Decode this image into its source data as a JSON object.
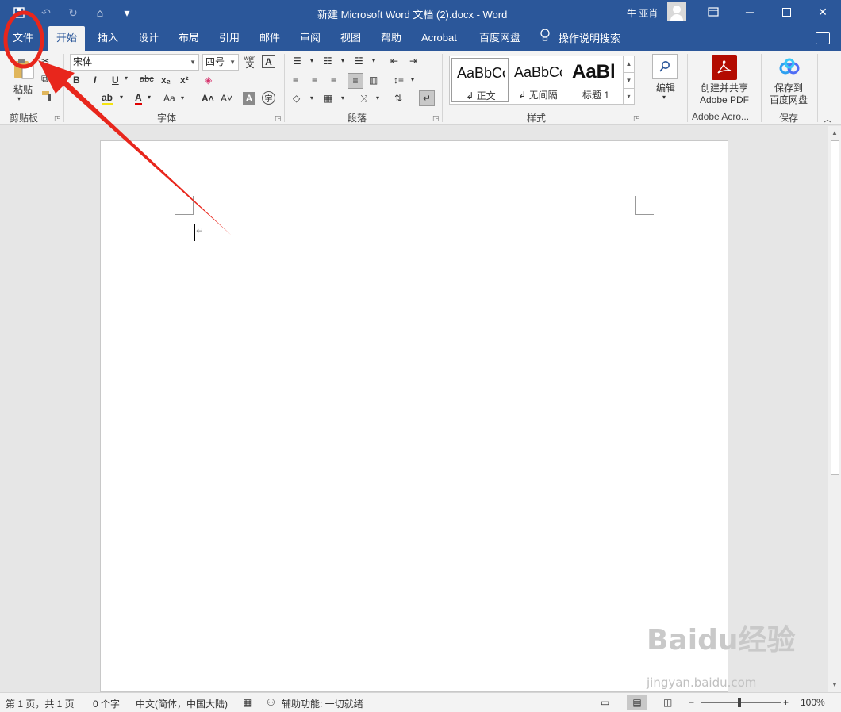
{
  "titlebar": {
    "doc_title": "新建 Microsoft Word 文档 (2).docx  -  Word",
    "user_name": "牛 亚肖",
    "bg_color": "#2b579a"
  },
  "tabs": [
    {
      "label": "文件"
    },
    {
      "label": "开始"
    },
    {
      "label": "插入"
    },
    {
      "label": "设计"
    },
    {
      "label": "布局"
    },
    {
      "label": "引用"
    },
    {
      "label": "邮件"
    },
    {
      "label": "审阅"
    },
    {
      "label": "视图"
    },
    {
      "label": "帮助"
    },
    {
      "label": "Acrobat"
    },
    {
      "label": "百度网盘"
    }
  ],
  "tell_me": "操作说明搜索",
  "ribbon": {
    "clipboard": {
      "paste": "粘贴",
      "label": "剪贴板"
    },
    "font": {
      "name": "宋体",
      "size": "四号",
      "label": "字体",
      "wen": "wén",
      "wen_char": "文"
    },
    "paragraph": {
      "label": "段落"
    },
    "styles": {
      "label": "样式",
      "items": [
        {
          "sample": "AaBbCcI",
          "name": "↲ 正文"
        },
        {
          "sample": "AaBbCcI",
          "name": "↲ 无间隔"
        },
        {
          "sample": "AaBl",
          "name": "标题 1"
        }
      ]
    },
    "editing": {
      "label": "编辑"
    },
    "acrobat": {
      "button": "创建并共享\nAdobe PDF",
      "line1": "创建并共享",
      "line2": "Adobe PDF",
      "label": "Adobe Acro..."
    },
    "baidu": {
      "line1": "保存到",
      "line2": "百度网盘",
      "label": "保存"
    }
  },
  "document": {
    "paragraph_mark": "↵"
  },
  "statusbar": {
    "page": "第 1 页，共 1 页",
    "words": "0 个字",
    "language": "中文(简体，中国大陆)",
    "accessibility": "辅助功能: 一切就绪",
    "zoom": "100%",
    "zoom_minus": "−",
    "zoom_plus": "+"
  },
  "watermark": {
    "brand": "Baidu经验",
    "url": "jingyan.baidu.com"
  },
  "annotation": {
    "color": "#e8261c",
    "target": "文件"
  }
}
